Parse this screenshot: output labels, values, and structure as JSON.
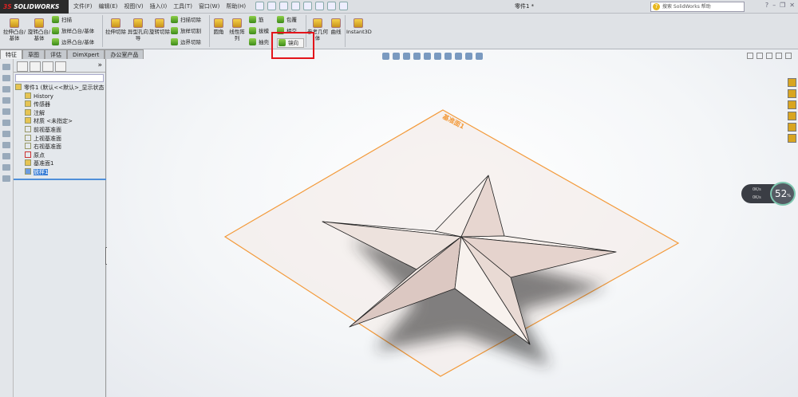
{
  "app": {
    "brand": "SOLIDWORKS",
    "doc_title": "零件1 *",
    "help_search_placeholder": "搜索 SolidWorks 帮助"
  },
  "menu": [
    "文件(F)",
    "编辑(E)",
    "视图(V)",
    "插入(I)",
    "工具(T)",
    "窗口(W)",
    "帮助(H)"
  ],
  "ribbon": {
    "extrude_boss": "拉伸凸台/基体",
    "revolve_boss": "旋转凸台/基体",
    "sweep": "扫描",
    "loft_boss": "放样凸台/基体",
    "boundary_boss": "边界凸台/基体",
    "extrude_cut": "拉伸切除",
    "hole_wizard": "异型孔向导",
    "revolve_cut": "旋转切除",
    "swept_cut": "扫描切除",
    "lofted_cut": "放样切割",
    "boundary_cut": "边界切除",
    "fillet": "圆角",
    "linear_pattern": "线性阵列",
    "rib": "筋",
    "draft": "拔模",
    "shell": "抽壳",
    "wrap": "包覆",
    "intersect": "相交",
    "mirror": "镜向",
    "ref_geometry": "参考几何体",
    "curves": "曲线",
    "instant3d": "Instant3D"
  },
  "tabs": [
    "特征",
    "草图",
    "评估",
    "DimXpert",
    "办公室产品"
  ],
  "tree": {
    "root": "零件1 (默认<<默认>_显示状态",
    "items": [
      "History",
      "传感器",
      "注解",
      "材质 <未指定>",
      "前视基准面",
      "上视基准面",
      "右视基准面",
      "原点",
      "基准面1",
      "放样1"
    ]
  },
  "viewport": {
    "plane_label": "基准面1"
  },
  "net_monitor": {
    "up": "0K/s",
    "down": "0K/s",
    "percent": "52",
    "unit": "%"
  },
  "colors": {
    "plane": "#f39a3a",
    "highlight": "#e3141a",
    "selection": "#3b7fd6"
  }
}
